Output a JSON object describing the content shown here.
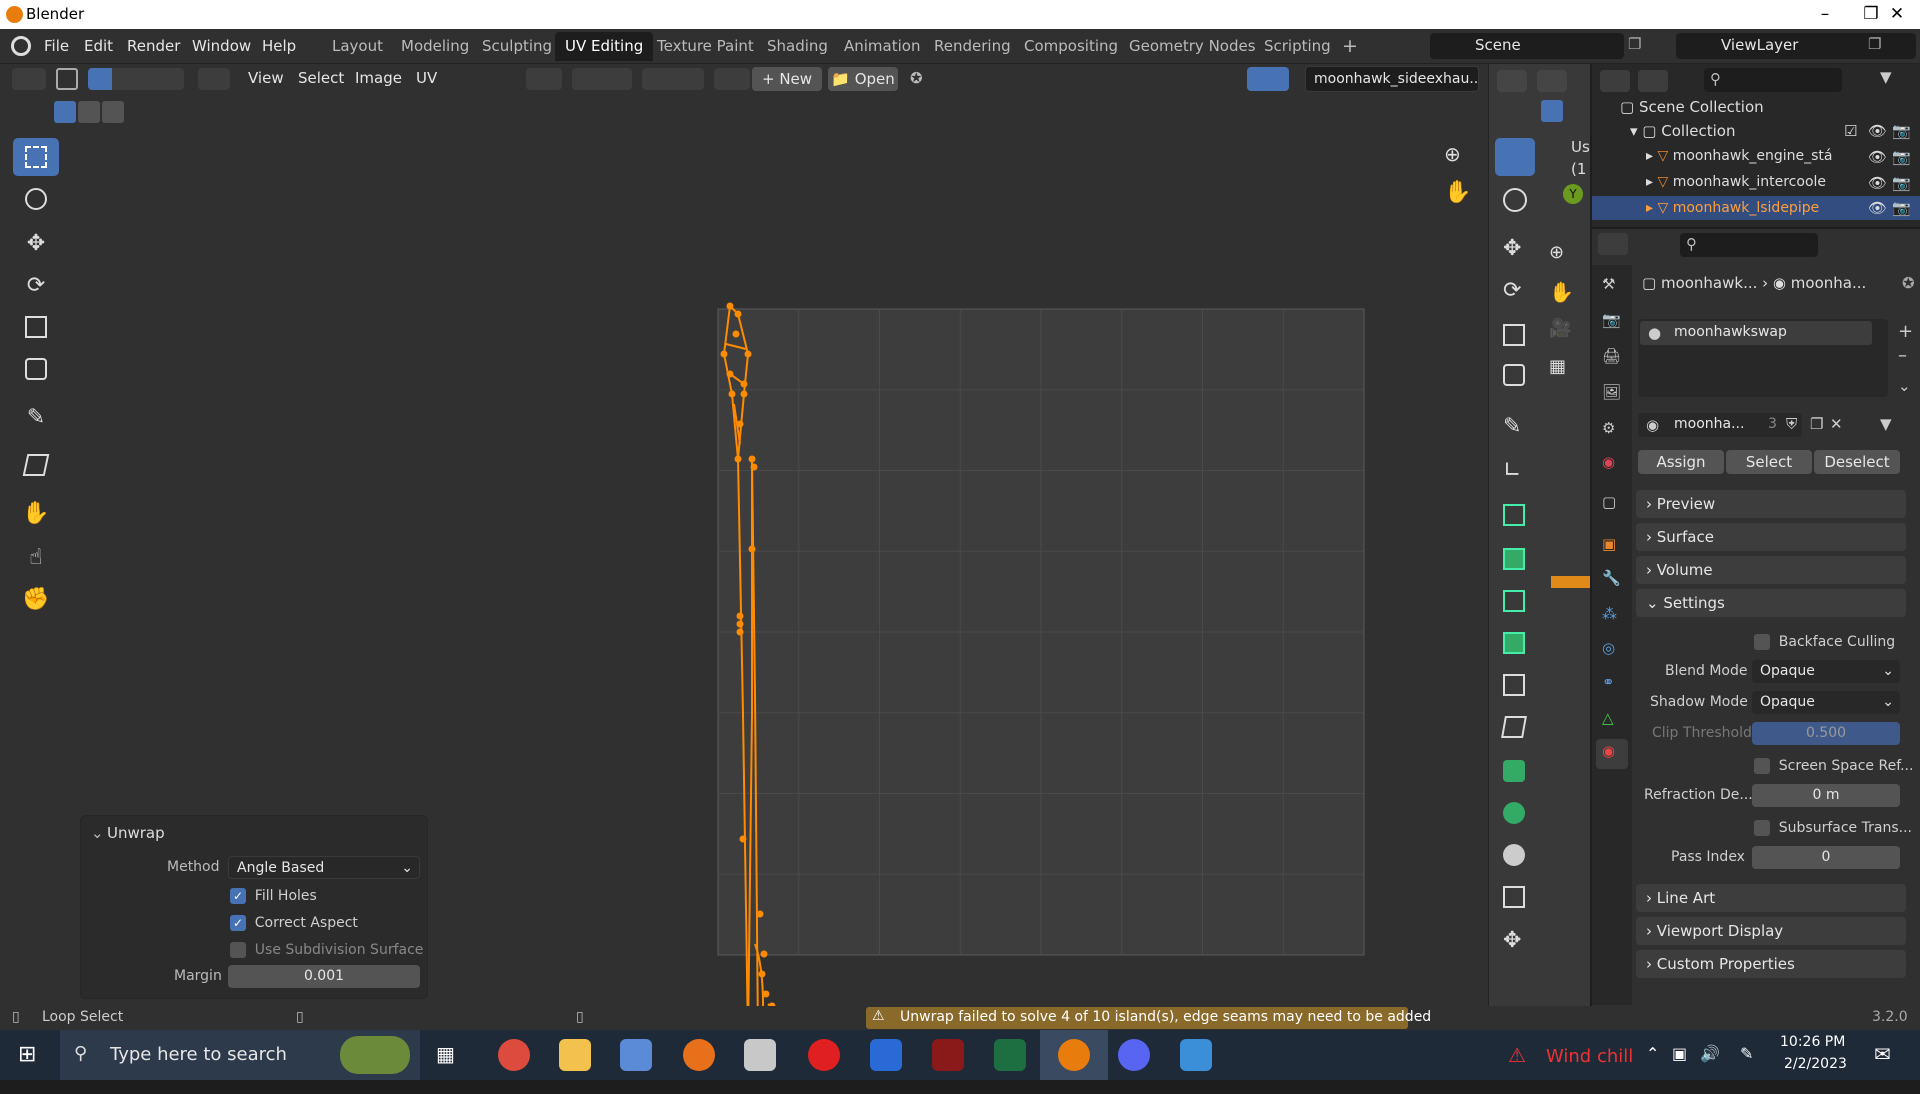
{
  "window": {
    "title": "Blender"
  },
  "menubar": [
    "File",
    "Edit",
    "Render",
    "Window",
    "Help"
  ],
  "workspaces": [
    "Layout",
    "Modeling",
    "Sculpting",
    "UV Editing",
    "Texture Paint",
    "Shading",
    "Animation",
    "Rendering",
    "Compositing",
    "Geometry Nodes",
    "Scripting"
  ],
  "active_workspace": "UV Editing",
  "scene": {
    "label": "Scene"
  },
  "view_layer": {
    "label": "ViewLayer"
  },
  "uv_header": {
    "menus": [
      "View",
      "Select",
      "Image",
      "UV"
    ],
    "new_label": "New",
    "open_label": "Open",
    "image_name": "moonhawk_sideexhau..."
  },
  "viewport3d": {
    "label_top": "Us",
    "label_sub": "(1"
  },
  "outliner": {
    "root": "Scene Collection",
    "collection": "Collection",
    "items": [
      "moonhawk_engine_stá",
      "moonhawk_intercoole",
      "moonhawk_lsidepipe"
    ]
  },
  "properties": {
    "breadcrumb_obj": "moonhawk...",
    "breadcrumb_mat": "moonha...",
    "material_slot": "moonhawkswap",
    "material_field": "moonha...",
    "user_count": "3",
    "assign": "Assign",
    "select": "Select",
    "deselect": "Deselect",
    "panels": [
      "Preview",
      "Surface",
      "Volume",
      "Settings",
      "Line Art",
      "Viewport Display",
      "Custom Properties"
    ],
    "settings": {
      "backface_culling": "Backface Culling",
      "blend_mode_label": "Blend Mode",
      "blend_mode": "Opaque",
      "shadow_mode_label": "Shadow Mode",
      "shadow_mode": "Opaque",
      "clip_label": "Clip Threshold",
      "clip_value": "0.500",
      "ssr_label": "Screen Space Ref...",
      "refraction_label": "Refraction De...",
      "refraction_value": "0 m",
      "subsurface_label": "Subsurface Trans...",
      "pass_index_label": "Pass Index",
      "pass_index_value": "0"
    }
  },
  "unwrap_panel": {
    "title": "Unwrap",
    "method_label": "Method",
    "method_value": "Angle Based",
    "fill_holes": "Fill Holes",
    "fill_holes_checked": true,
    "correct_aspect": "Correct Aspect",
    "correct_aspect_checked": true,
    "use_subsurf": "Use Subdivision Surface",
    "use_subsurf_checked": false,
    "margin_label": "Margin",
    "margin_value": "0.001"
  },
  "status": {
    "left_hint": "Loop Select",
    "warning": "Unwrap failed to solve 4 of 10 island(s), edge seams may need to be added",
    "version": "3.2.0"
  },
  "taskbar": {
    "search_placeholder": "Type here to search",
    "weather": "Wind chill",
    "time": "10:26 PM",
    "date": "2/2/2023"
  },
  "colors": {
    "accent": "#4772b3",
    "uv_orange": "#ff8c00",
    "warning_bg": "#8a6a2a"
  }
}
